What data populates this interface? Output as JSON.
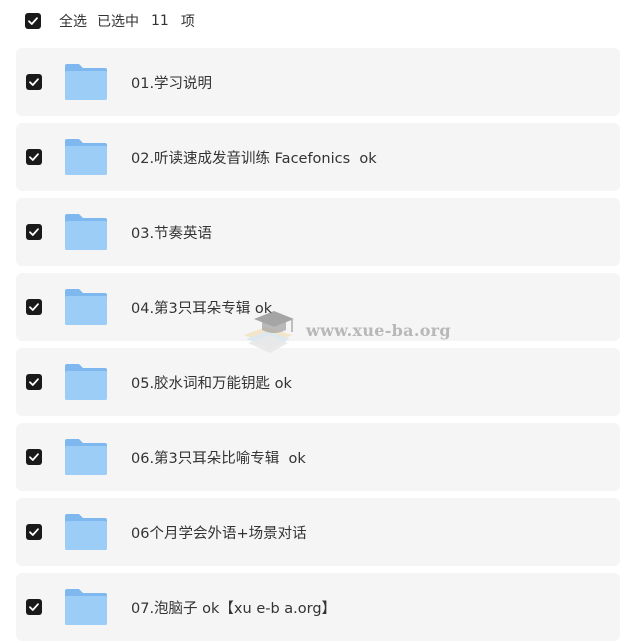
{
  "header": {
    "select_all_label": "全选",
    "selected_prefix": "已选中",
    "selected_count": "11",
    "selected_suffix": "项"
  },
  "items": [
    {
      "name": "01.学习说明",
      "checked": true
    },
    {
      "name": "02.听读速成发音训练 Facefonics  ok",
      "checked": true
    },
    {
      "name": "03.节奏英语",
      "checked": true
    },
    {
      "name": "04.第3只耳朵专辑 ok",
      "checked": true
    },
    {
      "name": "05.胶水词和万能钥匙 ok",
      "checked": true
    },
    {
      "name": "06.第3只耳朵比喻专辑  ok",
      "checked": true
    },
    {
      "name": "06个月学会外语+场景对话",
      "checked": true
    },
    {
      "name": "07.泡脑子 ok【xu e-b a.org】",
      "checked": true
    }
  ],
  "watermark": {
    "text": "www.xue-ba.org",
    "icon": "graduation-cap-books-icon"
  },
  "colors": {
    "checkbox": "#1a1a1a",
    "row_background": "#f5f5f6",
    "folder_front": "#9ccdf7",
    "folder_back": "#7fb8ef",
    "text": "#333333"
  }
}
